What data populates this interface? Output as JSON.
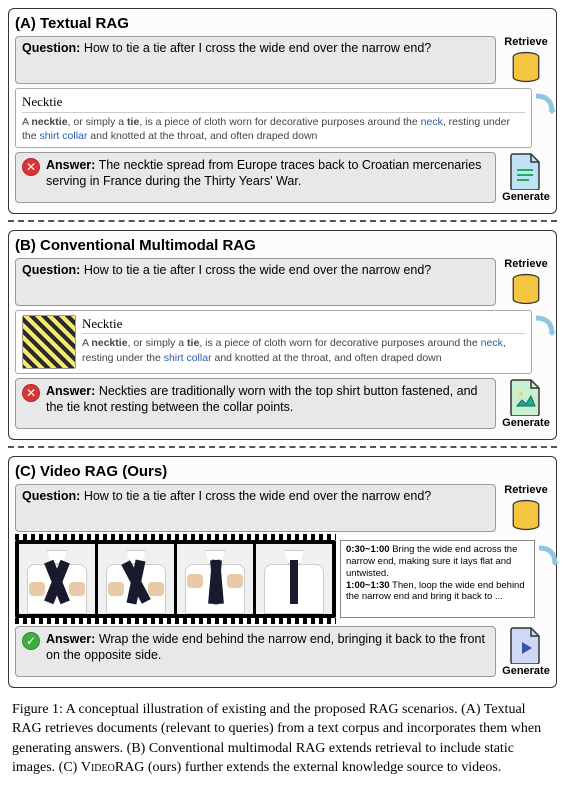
{
  "question_label": "Question:",
  "question_text": "How to tie a tie after I cross the wide end over the narrow end?",
  "answer_label": "Answer:",
  "retrieve_label": "Retrieve",
  "generate_label": "Generate",
  "retrieval_title": "Necktie",
  "retrieval_prefix": "A ",
  "retrieval_bold": "necktie",
  "retrieval_mid1": ", or simply a ",
  "retrieval_bold2": "tie",
  "retrieval_mid2": ", is a piece of cloth worn for decorative purposes around the ",
  "retrieval_link1": "neck",
  "retrieval_mid3": ", resting under the ",
  "retrieval_link2": "shirt collar",
  "retrieval_suffix": " and knotted at the throat, and often draped down",
  "panelA": {
    "title": "(A) Textual RAG",
    "answer": "The necktie spread from Europe traces back to Croatian mercenaries serving in France during the Thirty Years' War.",
    "correct": false
  },
  "panelB": {
    "title": "(B) Conventional Multimodal RAG",
    "answer": "Neckties are traditionally worn with the top shirt button fastened, and the tie knot resting between the collar points.",
    "correct": false
  },
  "panelC": {
    "title": "(C) Video RAG (Ours)",
    "transcript_t1": "0:30~1:00",
    "transcript_s1": " Bring the wide end across the narrow end, making sure it lays flat and untwisted.",
    "transcript_t2": "1:00~1:30",
    "transcript_s2": " Then, loop the wide end behind the narrow end and bring it back to ...",
    "answer": "Wrap the wide end behind the narrow end, bringing it back to the front on the opposite side.",
    "correct": true
  },
  "caption": {
    "lead": "Figure 1: A conceptual illustration of existing and the proposed RAG scenarios. (A) Textual RAG retrieves documents (relevant to queries) from a text corpus and incorporates them when generating answers. (B) Conventional multimodal RAG extends retrieval to include static images. (C) ",
    "brand": "VideoRAG",
    "tail": " (ours) further extends the external knowledge source to videos."
  },
  "icons": {
    "db_fill": "#f5c542",
    "docA_fill": "#bfe3f5",
    "docB_fill": "#c8f0d0",
    "docC_fill": "#cfd9f7"
  }
}
